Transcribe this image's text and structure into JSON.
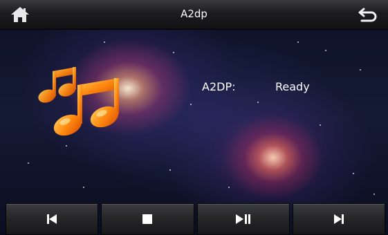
{
  "header": {
    "title": "A2dp"
  },
  "icons": {
    "home": "home-icon",
    "back": "back-arrow-icon",
    "music": "music-notes-icon"
  },
  "status": {
    "label": "A2DP:",
    "value": "Ready"
  },
  "controls": [
    {
      "name": "previous-button",
      "icon": "previous-track-icon"
    },
    {
      "name": "stop-button",
      "icon": "stop-icon"
    },
    {
      "name": "play-pause-button",
      "icon": "play-pause-icon"
    },
    {
      "name": "next-button",
      "icon": "next-track-icon"
    }
  ],
  "colors": {
    "accent": "#ff8a00",
    "text": "#ffffff",
    "bar": "#1c1c20"
  }
}
